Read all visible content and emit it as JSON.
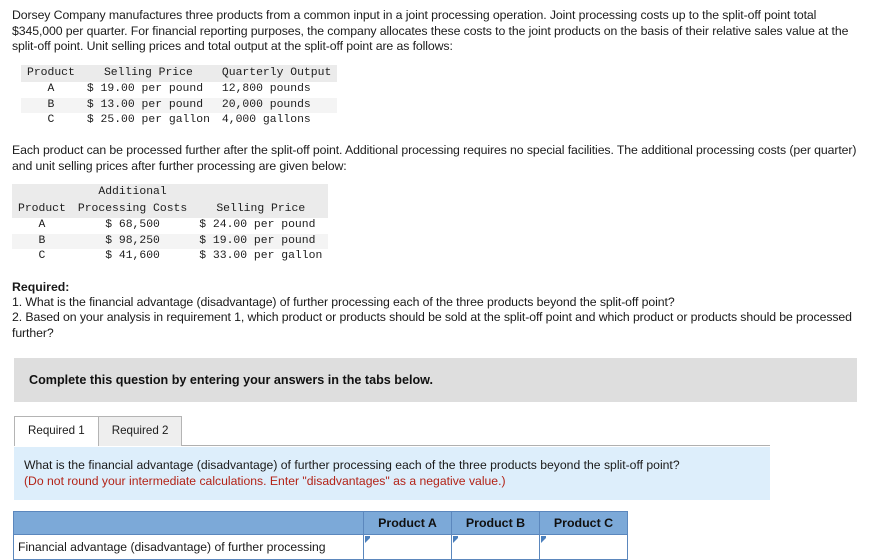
{
  "intro": {
    "paragraph": "Dorsey Company manufactures three products from a common input in a joint processing operation. Joint processing costs up to the split-off point total $345,000 per quarter. For financial reporting purposes, the company allocates these costs to the joint products on the basis of their relative sales value at the split-off point. Unit selling prices and total output at the split-off point are as follows:"
  },
  "table_splitoff": {
    "headers": [
      "Product",
      "Selling Price",
      "Quarterly Output"
    ],
    "rows": [
      {
        "product": "A",
        "selling_price": "$ 19.00 per pound",
        "output": "12,800 pounds"
      },
      {
        "product": "B",
        "selling_price": "$ 13.00 per pound",
        "output": "20,000 pounds"
      },
      {
        "product": "C",
        "selling_price": "$ 25.00 per gallon",
        "output": "4,000 gallons"
      }
    ]
  },
  "second_paragraph": "Each product can be processed further after the split-off point. Additional processing requires no special facilities. The additional processing costs (per quarter) and unit selling prices after further processing are given below:",
  "table_further": {
    "headers": [
      "Product",
      "Additional Processing Costs",
      "Selling Price"
    ],
    "header_line1": "Additional",
    "header_line2_col1": "Product",
    "header_line2_col2": "Processing Costs",
    "header_line2_col3": "Selling Price",
    "rows": [
      {
        "product": "A",
        "cost": "$ 68,500",
        "selling_price": "$ 24.00 per pound"
      },
      {
        "product": "B",
        "cost": "$ 98,250",
        "selling_price": "$ 19.00 per pound"
      },
      {
        "product": "C",
        "cost": "$ 41,600",
        "selling_price": "$ 33.00 per gallon"
      }
    ]
  },
  "required": {
    "heading": "Required:",
    "item1": "1. What is the financial advantage (disadvantage) of further processing each of the three products beyond the split-off point?",
    "item2": "2. Based on your analysis in requirement 1, which product or products should be sold at the split-off point and which product or products should be processed further?"
  },
  "banner": {
    "text": "Complete this question by entering your answers in the tabs below."
  },
  "tabs": [
    {
      "label": "Required 1",
      "active": true
    },
    {
      "label": "Required 2",
      "active": false
    }
  ],
  "instruction_panel": {
    "question": "What is the financial advantage (disadvantage) of further processing each of the three products beyond the split-off point?",
    "note": "(Do not round your intermediate calculations. Enter \"disadvantages\" as a negative value.)",
    "background_color": "#ddeefb",
    "note_color": "#b32317"
  },
  "answer_table": {
    "header_accent_color": "#7ca9d8",
    "columns": [
      "",
      "Product A",
      "Product B",
      "Product C"
    ],
    "rows": [
      {
        "label": "Financial advantage (disadvantage) of further processing",
        "product_a": "",
        "product_b": "",
        "product_c": ""
      }
    ]
  }
}
